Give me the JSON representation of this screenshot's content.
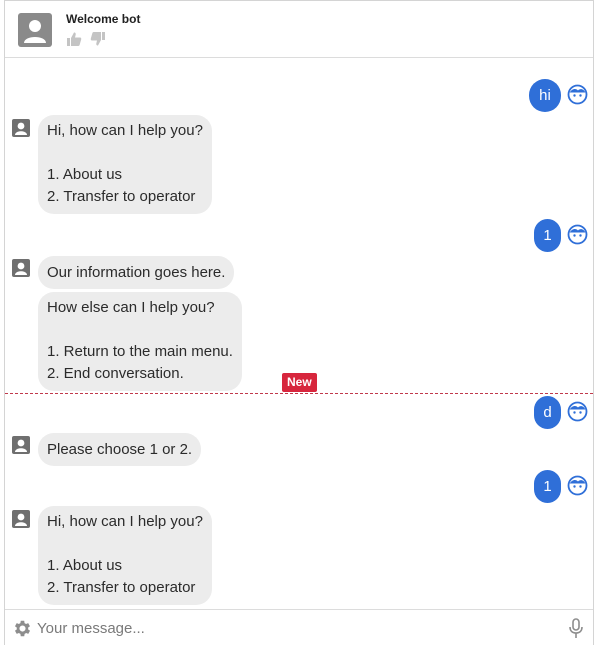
{
  "header": {
    "title": "Welcome bot",
    "avatar_icon": "user-silhouette-icon",
    "thumbs_up_icon": "thumbs-up-icon",
    "thumbs_down_icon": "thumbs-down-icon"
  },
  "messages": [
    {
      "sender": "user",
      "text": "hi"
    },
    {
      "sender": "bot",
      "text": "Hi, how can I help you?\n\n1. About us\n2. Transfer to operator"
    },
    {
      "sender": "user",
      "text": "1"
    },
    {
      "sender": "bot",
      "text": "Our information goes here."
    },
    {
      "sender": "bot",
      "text": "How else can I help you?\n\n1. Return to the main menu.\n2. End conversation."
    },
    {
      "sender": "user",
      "text": "d"
    },
    {
      "sender": "bot",
      "text": "Please choose 1 or 2."
    },
    {
      "sender": "user",
      "text": "1"
    },
    {
      "sender": "bot",
      "text": "Hi, how can I help you?\n\n1. About us\n2. Transfer to operator"
    }
  ],
  "new_divider": {
    "label": "New"
  },
  "input": {
    "placeholder": "Your message...",
    "value": "",
    "settings_icon": "gear-icon",
    "mic_icon": "microphone-icon"
  },
  "colors": {
    "user_bubble": "#2f6fd8",
    "bot_bubble": "#ececec",
    "new_badge": "#d7263d"
  }
}
